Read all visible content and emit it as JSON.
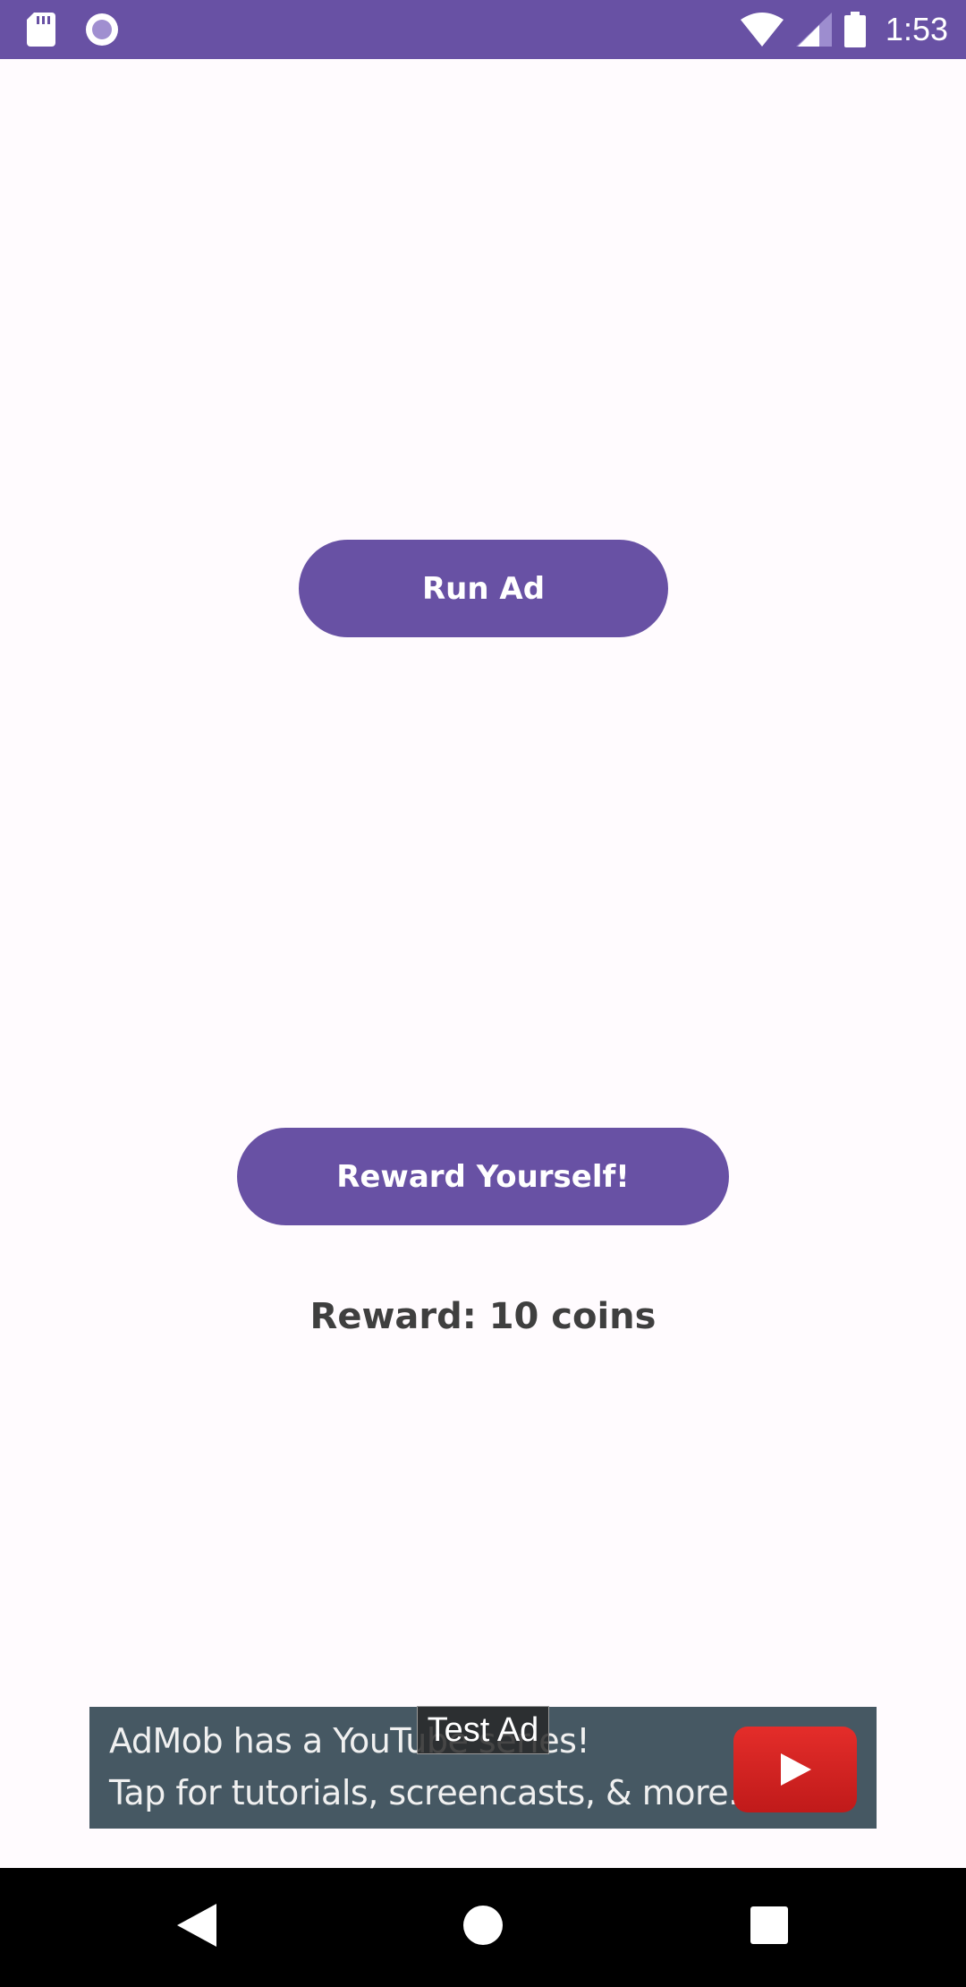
{
  "status_bar": {
    "time": "1:53",
    "icons": [
      "sd-card-icon",
      "media-record-icon",
      "wifi-icon",
      "signal-icon",
      "battery-icon"
    ],
    "color": "#6851A4"
  },
  "main": {
    "run_ad_label": "Run Ad",
    "reward_button_label": "Reward Yourself!",
    "reward_text": "Reward: 10 coins",
    "accent_color": "#6851A4"
  },
  "ad": {
    "line1": "AdMob has a YouTube series!",
    "line2": "Tap for tutorials, screencasts, & more.",
    "test_label": "Test Ad",
    "logo": "youtube-play-icon",
    "background": "#465863"
  },
  "nav_bar": {
    "buttons": [
      "back-icon",
      "home-icon",
      "recents-icon"
    ]
  }
}
